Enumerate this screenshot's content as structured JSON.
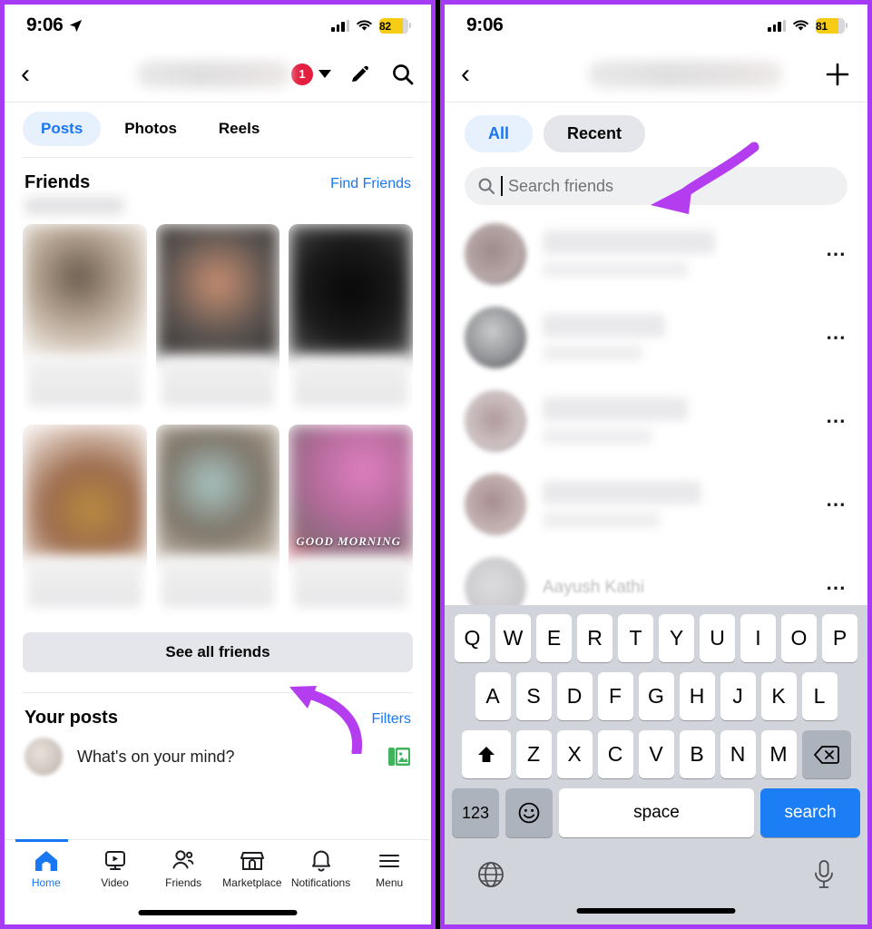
{
  "annotation": {
    "color": "#a53bf5",
    "arrows": [
      "arrow-to-see-all-friends",
      "arrow-to-search-friends"
    ]
  },
  "left_phone": {
    "status_bar": {
      "time": "9:06",
      "location_icon": "location-arrow-icon",
      "cellular": "cellular-signal-icon",
      "wifi": "wifi-icon",
      "battery_percent": "82"
    },
    "nav": {
      "back_icon": "chevron-left-icon",
      "title_blurred": "",
      "badge_count": "1",
      "dropdown_icon": "caret-down-icon",
      "edit_icon": "pencil-icon",
      "search_icon": "search-icon"
    },
    "tabs": [
      {
        "label": "Posts",
        "active": true
      },
      {
        "label": "Photos",
        "active": false
      },
      {
        "label": "Reels",
        "active": false
      }
    ],
    "friends_section": {
      "title": "Friends",
      "action": "Find Friends",
      "count_blurred": ""
    },
    "friend_cards": [
      {
        "name_blurred": "",
        "overlay_text": ""
      },
      {
        "name_blurred": "",
        "overlay_text": ""
      },
      {
        "name_blurred": "",
        "overlay_text": ""
      },
      {
        "name_blurred": "",
        "overlay_text": ""
      },
      {
        "name_blurred": "",
        "overlay_text": ""
      },
      {
        "name_blurred": "",
        "overlay_text": "GOOD MORNING"
      }
    ],
    "see_all_friends": "See all friends",
    "your_posts": {
      "title": "Your posts",
      "action": "Filters"
    },
    "composer": {
      "placeholder": "What's on your mind?",
      "photo_icon": "photo-library-icon",
      "avatar": "user-avatar"
    },
    "bottom_nav": [
      {
        "label": "Home",
        "icon": "home-icon",
        "active": true
      },
      {
        "label": "Video",
        "icon": "video-icon",
        "active": false
      },
      {
        "label": "Friends",
        "icon": "friends-icon",
        "active": false
      },
      {
        "label": "Marketplace",
        "icon": "store-icon",
        "active": false
      },
      {
        "label": "Notifications",
        "icon": "bell-icon",
        "active": false
      },
      {
        "label": "Menu",
        "icon": "hamburger-icon",
        "active": false
      }
    ]
  },
  "right_phone": {
    "status_bar": {
      "time": "9:06",
      "cellular": "cellular-signal-icon",
      "wifi": "wifi-icon",
      "battery_percent": "81"
    },
    "nav": {
      "back_icon": "chevron-left-icon",
      "title_blurred": "",
      "add_icon": "plus-icon"
    },
    "filter_pills": [
      {
        "label": "All",
        "active": true
      },
      {
        "label": "Recent",
        "active": false
      }
    ],
    "search": {
      "placeholder": "Search friends",
      "value": "",
      "icon": "search-icon",
      "caret_visible": true
    },
    "friend_rows": [
      {
        "name_blurred": "",
        "subtitle_blurred": "",
        "menu_icon": "more-horizontal-icon"
      },
      {
        "name_blurred": "",
        "subtitle_blurred": "",
        "menu_icon": "more-horizontal-icon"
      },
      {
        "name_blurred": "",
        "subtitle_blurred": "",
        "menu_icon": "more-horizontal-icon"
      },
      {
        "name_blurred": "",
        "subtitle_blurred": "",
        "menu_icon": "more-horizontal-icon"
      },
      {
        "name_blurred": "Aayush Kathi",
        "subtitle_blurred": "",
        "menu_icon": "more-horizontal-icon"
      }
    ],
    "keyboard": {
      "row1": [
        "Q",
        "W",
        "E",
        "R",
        "T",
        "Y",
        "U",
        "I",
        "O",
        "P"
      ],
      "row2": [
        "A",
        "S",
        "D",
        "F",
        "G",
        "H",
        "J",
        "K",
        "L"
      ],
      "row3_shift_icon": "shift-icon",
      "row3": [
        "Z",
        "X",
        "C",
        "V",
        "B",
        "N",
        "M"
      ],
      "row3_delete_icon": "backspace-icon",
      "numbers_key": "123",
      "emoji_key": "emoji-icon",
      "space_key": "space",
      "return_key": "search",
      "globe_icon": "globe-icon",
      "mic_icon": "microphone-icon"
    }
  }
}
